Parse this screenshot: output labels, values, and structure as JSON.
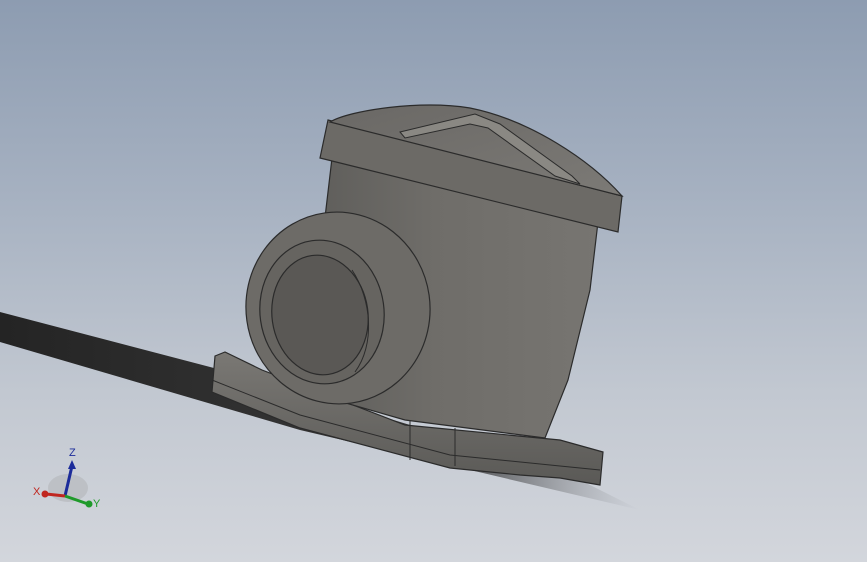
{
  "triad": {
    "x_label": "X",
    "y_label": "Y",
    "z_label": "Z"
  },
  "colors": {
    "background_top": "#8d9cb1",
    "background_bottom": "#d3d6dc",
    "part_body": "#6e6c68",
    "part_shadow": "#2e2e2e",
    "axis_x": "#c0261f",
    "axis_y": "#1f9a2a",
    "axis_z": "#1c2c9a"
  },
  "icons": {
    "triad": "view-orientation-triad-icon"
  }
}
